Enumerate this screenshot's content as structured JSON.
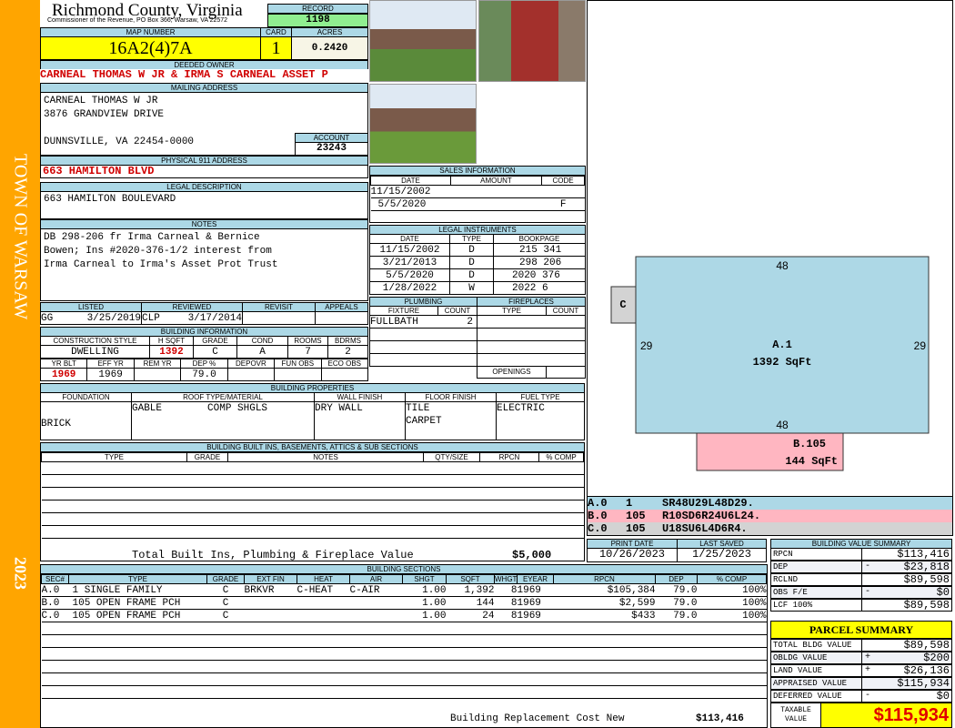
{
  "side": {
    "town": "TOWN OF WARSAW",
    "year": "2023"
  },
  "header": {
    "county": "Richmond County, Virginia",
    "subtitle": "Commissioner of the Revenue, PO Box 366, Warsaw, VA 22572",
    "record_label": "RECORD",
    "record": "1198"
  },
  "parcel": {
    "map_label": "MAP NUMBER",
    "map": "16A2(4)7A",
    "card_label": "CARD",
    "card": "1",
    "acres_label": "ACRES",
    "acres": "0.2420"
  },
  "owner": {
    "label": "DEEDED OWNER",
    "name": "CARNEAL THOMAS W JR & IRMA S CARNEAL ASSET P",
    "mail_label": "MAILING ADDRESS",
    "mail": [
      "CARNEAL THOMAS W JR",
      "3876 GRANDVIEW DRIVE",
      "",
      "DUNNSVILLE, VA 22454-0000"
    ],
    "account_label": "ACCOUNT",
    "account": "23243"
  },
  "physical": {
    "label": "PHYSICAL 911 ADDRESS",
    "value": "663 HAMILTON BLVD"
  },
  "legal": {
    "label": "LEGAL DESCRIPTION",
    "value": "663 HAMILTON BOULEVARD"
  },
  "notes": {
    "label": "NOTES",
    "lines": [
      "DB 298-206 fr Irma Carneal & Bernice",
      "Bowen; Ins #2020-376-1/2 interest from",
      "Irma Carneal to Irma's Asset Prot Trust"
    ]
  },
  "review": {
    "headers": [
      "LISTED",
      "REVIEWED",
      "REVISIT",
      "APPEALS"
    ],
    "listed_by": "GG",
    "listed": "3/25/2019",
    "reviewed_by": "CLP",
    "reviewed": "3/17/2014"
  },
  "bldg_info": {
    "label": "BUILDING INFORMATION",
    "h1": [
      "CONSTRUCTION STYLE",
      "H SQFT",
      "GRADE",
      "COND",
      "ROOMS",
      "BDRMS"
    ],
    "v1": [
      "DWELLING",
      "1392",
      "C",
      "A",
      "7",
      "2"
    ],
    "h2": [
      "YR BLT",
      "EFF YR",
      "REM YR",
      "DEP %",
      "DEPOVR",
      "FUN OBS",
      "ECO OBS"
    ],
    "v2": [
      "1969",
      "1969",
      "",
      "79.0",
      "",
      "",
      ""
    ]
  },
  "sales": {
    "label": "SALES INFORMATION",
    "headers": [
      "DATE",
      "AMOUNT",
      "CODE"
    ],
    "rows": [
      [
        "11/15/2002",
        "",
        ""
      ],
      [
        "5/5/2020",
        "",
        "F"
      ]
    ]
  },
  "instruments": {
    "label": "LEGAL INSTRUMENTS",
    "headers": [
      "DATE",
      "TYPE",
      "BOOKPAGE"
    ],
    "rows": [
      [
        "11/15/2002",
        "D",
        "215 341"
      ],
      [
        "3/21/2013",
        "D",
        "298 206"
      ],
      [
        "5/5/2020",
        "D",
        "2020 376"
      ],
      [
        "1/28/2022",
        "W",
        "2022 6"
      ]
    ]
  },
  "plumbing": {
    "label": "PLUMBING",
    "headers": [
      "FIXTURE",
      "COUNT"
    ],
    "rows": [
      [
        "FULLBATH",
        "2"
      ]
    ]
  },
  "fireplaces": {
    "label": "FIREPLACES",
    "headers": [
      "TYPE",
      "COUNT"
    ],
    "openings": "OPENINGS"
  },
  "properties": {
    "label": "BUILDING PROPERTIES",
    "headers": [
      "FOUNDATION",
      "ROOF TYPE/MATERIAL",
      "WALL FINISH",
      "FLOOR FINISH",
      "FUEL TYPE"
    ],
    "foundation": "BRICK",
    "roof_type": "GABLE",
    "roof_material": "COMP SHGLS",
    "wall": "DRY WALL",
    "floor": [
      "TILE",
      "CARPET"
    ],
    "fuel": "ELECTRIC"
  },
  "builtins": {
    "label": "BUILDING BUILT INS, BASEMENTS, ATTICS & SUB SECTIONS",
    "headers": [
      "TYPE",
      "GRADE",
      "NOTES",
      "QTY/SIZE",
      "RPCN",
      "% COMP"
    ],
    "total_label": "Total Built Ins, Plumbing & Fireplace Value",
    "total": "$5,000"
  },
  "dates": {
    "print_label": "PRINT DATE",
    "print": "10/26/2023",
    "saved_label": "LAST SAVED",
    "saved": "1/25/2023"
  },
  "sections": {
    "label": "BUILDING SECTIONS",
    "headers": [
      "SEC#",
      "TYPE",
      "GRADE",
      "EXT FIN",
      "HEAT",
      "AIR",
      "SHGT",
      "SQFT",
      "WHGT",
      "EYEAR",
      "RPCN",
      "DEP",
      "% COMP"
    ],
    "rows": [
      [
        "A.0",
        "1 SINGLE FAMILY",
        "C",
        "BRKVR",
        "C-HEAT",
        "C-AIR",
        "1.00",
        "1,392",
        "8",
        "1969",
        "$105,384",
        "79.0",
        "100%"
      ],
      [
        "B.0",
        "105 OPEN FRAME PCH",
        "C",
        "",
        "",
        "",
        "1.00",
        "144",
        "8",
        "1969",
        "$2,599",
        "79.0",
        "100%"
      ],
      [
        "C.0",
        "105 OPEN FRAME PCH",
        "C",
        "",
        "",
        "",
        "1.00",
        "24",
        "8",
        "1969",
        "$433",
        "79.0",
        "100%"
      ]
    ],
    "footer_label": "Building Replacement Cost New",
    "footer_value": "$113,416"
  },
  "sketch": {
    "a_top": "48",
    "a_bottom": "48",
    "a_left": "29",
    "a_right": "29",
    "a_label": "A.1",
    "a_area": "1392 SqFt",
    "b_label": "B.105",
    "b_area": "144 SqFt",
    "c_label": "C",
    "codes": [
      [
        "A.0",
        "1",
        "SR48U29L48D29."
      ],
      [
        "B.0",
        "105",
        "R10SD6R24U6L24."
      ],
      [
        "C.0",
        "105",
        "U18SU6L4D6R4."
      ]
    ],
    "colors": {
      "a": "#add8e6",
      "b": "#ffb6c1",
      "c": "#d3d3d3"
    }
  },
  "bvs": {
    "label": "BUILDING VALUE SUMMARY",
    "rows": [
      [
        "RPCN",
        "",
        "$113,416"
      ],
      [
        "DEP",
        "-",
        "$23,818"
      ],
      [
        "RCLND",
        "",
        "$89,598"
      ],
      [
        "OBS F/E",
        "-",
        "$0"
      ],
      [
        "LCF 100%",
        "",
        "$89,598"
      ]
    ]
  },
  "summary": {
    "label": "PARCEL SUMMARY",
    "rows": [
      [
        "TOTAL BLDG VALUE",
        "",
        "$89,598"
      ],
      [
        "OBLDG VALUE",
        "+",
        "$200"
      ],
      [
        "LAND VALUE",
        "+",
        "$26,136"
      ],
      [
        "APPRAISED VALUE",
        "",
        "$115,934"
      ],
      [
        "DEFERRED VALUE",
        "-",
        "$0"
      ]
    ],
    "taxable_label": "TAXABLE VALUE",
    "taxable": "$115,934"
  }
}
